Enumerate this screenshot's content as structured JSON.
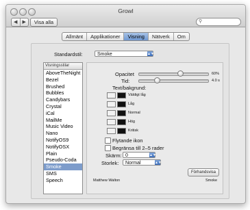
{
  "window": {
    "title": "Growl"
  },
  "toolbar": {
    "back": "◀",
    "forward": "▶",
    "show_all": "Visa alla",
    "search_placeholder": ""
  },
  "tabs": [
    "Allmänt",
    "Applikationer",
    "Visning",
    "Nätverk",
    "Om"
  ],
  "active_tab": "Visning",
  "default_style": {
    "label": "Standardstil:",
    "value": "Smoke"
  },
  "styles_list": {
    "header": "Visningsstilar",
    "items": [
      "AboveTheNight",
      "Bezel",
      "Brushed",
      "Bubbles",
      "Candybars",
      "Crystal",
      "iCal",
      "MailMe",
      "Music Video",
      "Nano",
      "NotifyOS9",
      "NotifyOSX",
      "Plain",
      "Pseudo-Coda",
      "Smoke",
      "SMS",
      "Speech"
    ],
    "selected": "Smoke"
  },
  "settings": {
    "opacity_label": "Opacitet",
    "opacity_value": "60%",
    "opacity_fraction": 0.6,
    "duration_label": "Tid:",
    "duration_value": "4.0 s",
    "duration_fraction": 0.27,
    "text_bg_label": "Text/bakgrund:",
    "priorities": [
      {
        "label": "Väldigt låg",
        "text_color": "#f2f2f2",
        "bg_color": "#111111"
      },
      {
        "label": "Låg",
        "text_color": "#f2f2f2",
        "bg_color": "#111111"
      },
      {
        "label": "Normal",
        "text_color": "#f2f2f2",
        "bg_color": "#111111"
      },
      {
        "label": "Hög",
        "text_color": "#f2f2f2",
        "bg_color": "#111111"
      },
      {
        "label": "Kritisk",
        "text_color": "#f2f2f2",
        "bg_color": "#111111"
      }
    ],
    "floating_icon_label": "Flytande ikon",
    "limit_rows_label": "Begränsa till 2–5 rader",
    "screen_label": "Skärm:",
    "screen_value": "0",
    "size_label": "Storlek:",
    "size_value": "Normal",
    "preview_button": "Förhandsvisa",
    "author": "Matthew Walton",
    "style_name": "Smoke"
  }
}
